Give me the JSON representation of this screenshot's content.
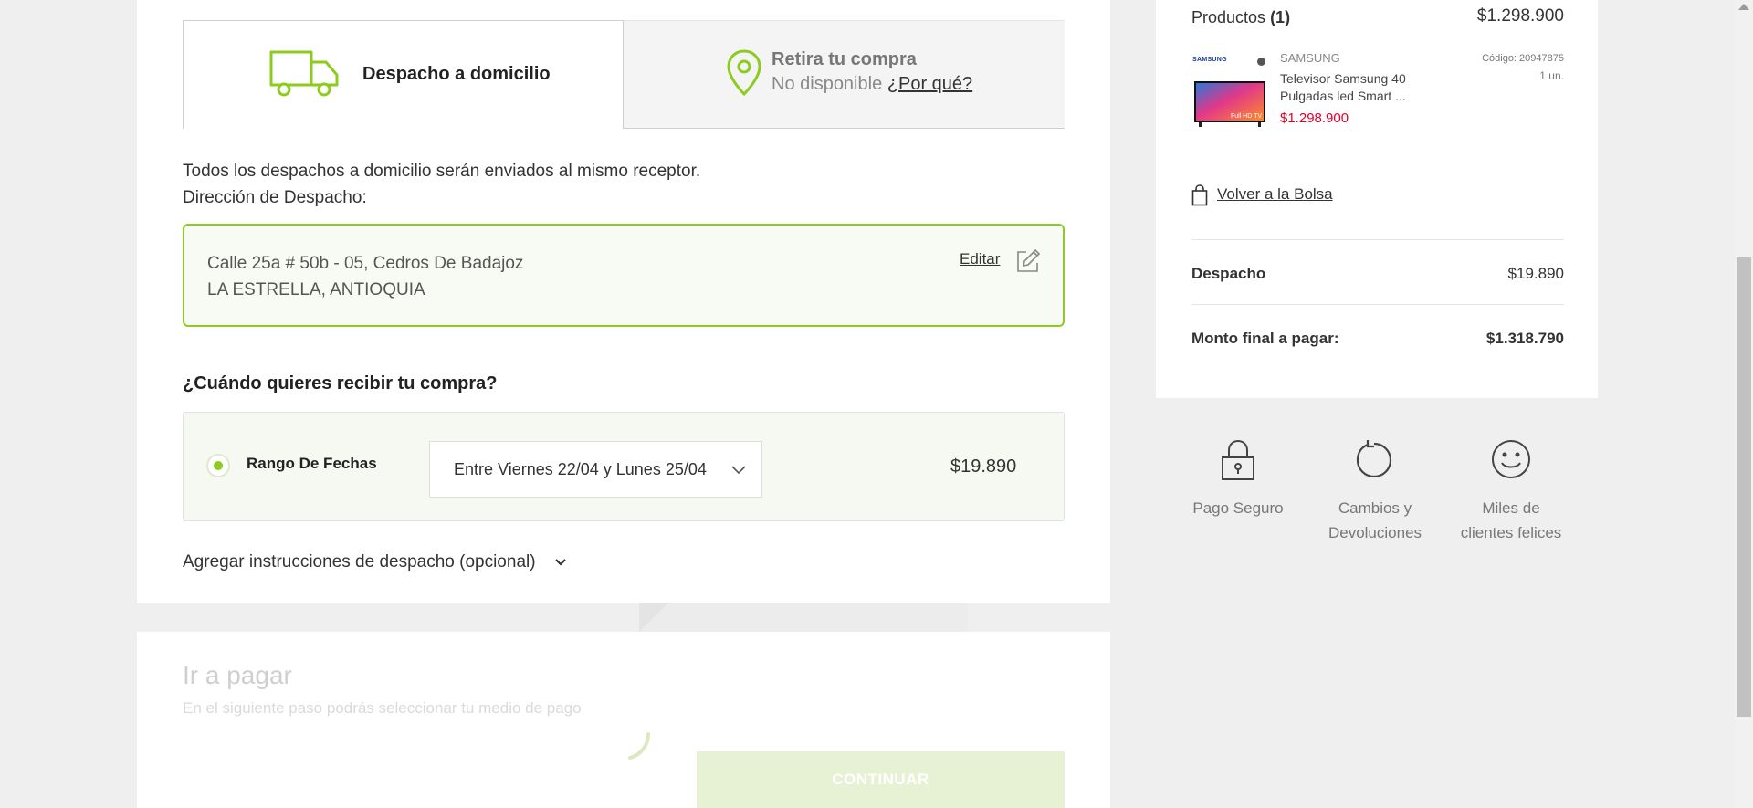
{
  "shipping_tabs": {
    "home_delivery": "Despacho a domicilio",
    "pickup_title": "Retira tu compra",
    "pickup_unavailable": "No disponible",
    "pickup_why": "¿Por qué?"
  },
  "delivery": {
    "same_receiver_note": "Todos los despachos a domicilio serán enviados al mismo receptor.",
    "address_label": "Dirección de Despacho:",
    "address_line1": "Calle 25a # 50b - 05, Cedros De Badajoz",
    "address_line2": "LA ESTRELLA, ANTIOQUIA",
    "edit_label": "Editar"
  },
  "schedule": {
    "title": "¿Cuándo quieres recibir tu compra?",
    "option_label": "Rango De Fechas",
    "selected_range": "Entre Viernes 22/04 y Lunes 25/04",
    "price": "$19.890"
  },
  "instructions_label": "Agregar instrucciones de despacho (opcional)",
  "payment": {
    "title": "Ir a pagar",
    "subtitle": "En el siguiente paso podrás seleccionar tu medio de pago",
    "continue_label": "CONTINUAR"
  },
  "summary": {
    "products_label": "Productos",
    "products_count": "(1)",
    "products_total": "$1.298.900",
    "product": {
      "brand_logo": "SAMSUNG",
      "brand": "SAMSUNG",
      "name": "Televisor Samsung 40 Pulgadas led Smart ...",
      "price": "$1.298.900",
      "code": "Código: 20947875",
      "qty": "1 un.",
      "screen_text": "Full HD TV"
    },
    "back_link": "Volver a la Bolsa",
    "shipping_label": "Despacho",
    "shipping_value": "$19.890",
    "final_label": "Monto final a pagar:",
    "final_value": "$1.318.790"
  },
  "benefits": {
    "secure": "Pago Seguro",
    "returns_line1": "Cambios y",
    "returns_line2": "Devoluciones",
    "happy_line1": "Miles de",
    "happy_line2": "clientes felices"
  },
  "colors": {
    "accent_green": "#8ccc1e",
    "price_red": "#e4002b"
  }
}
